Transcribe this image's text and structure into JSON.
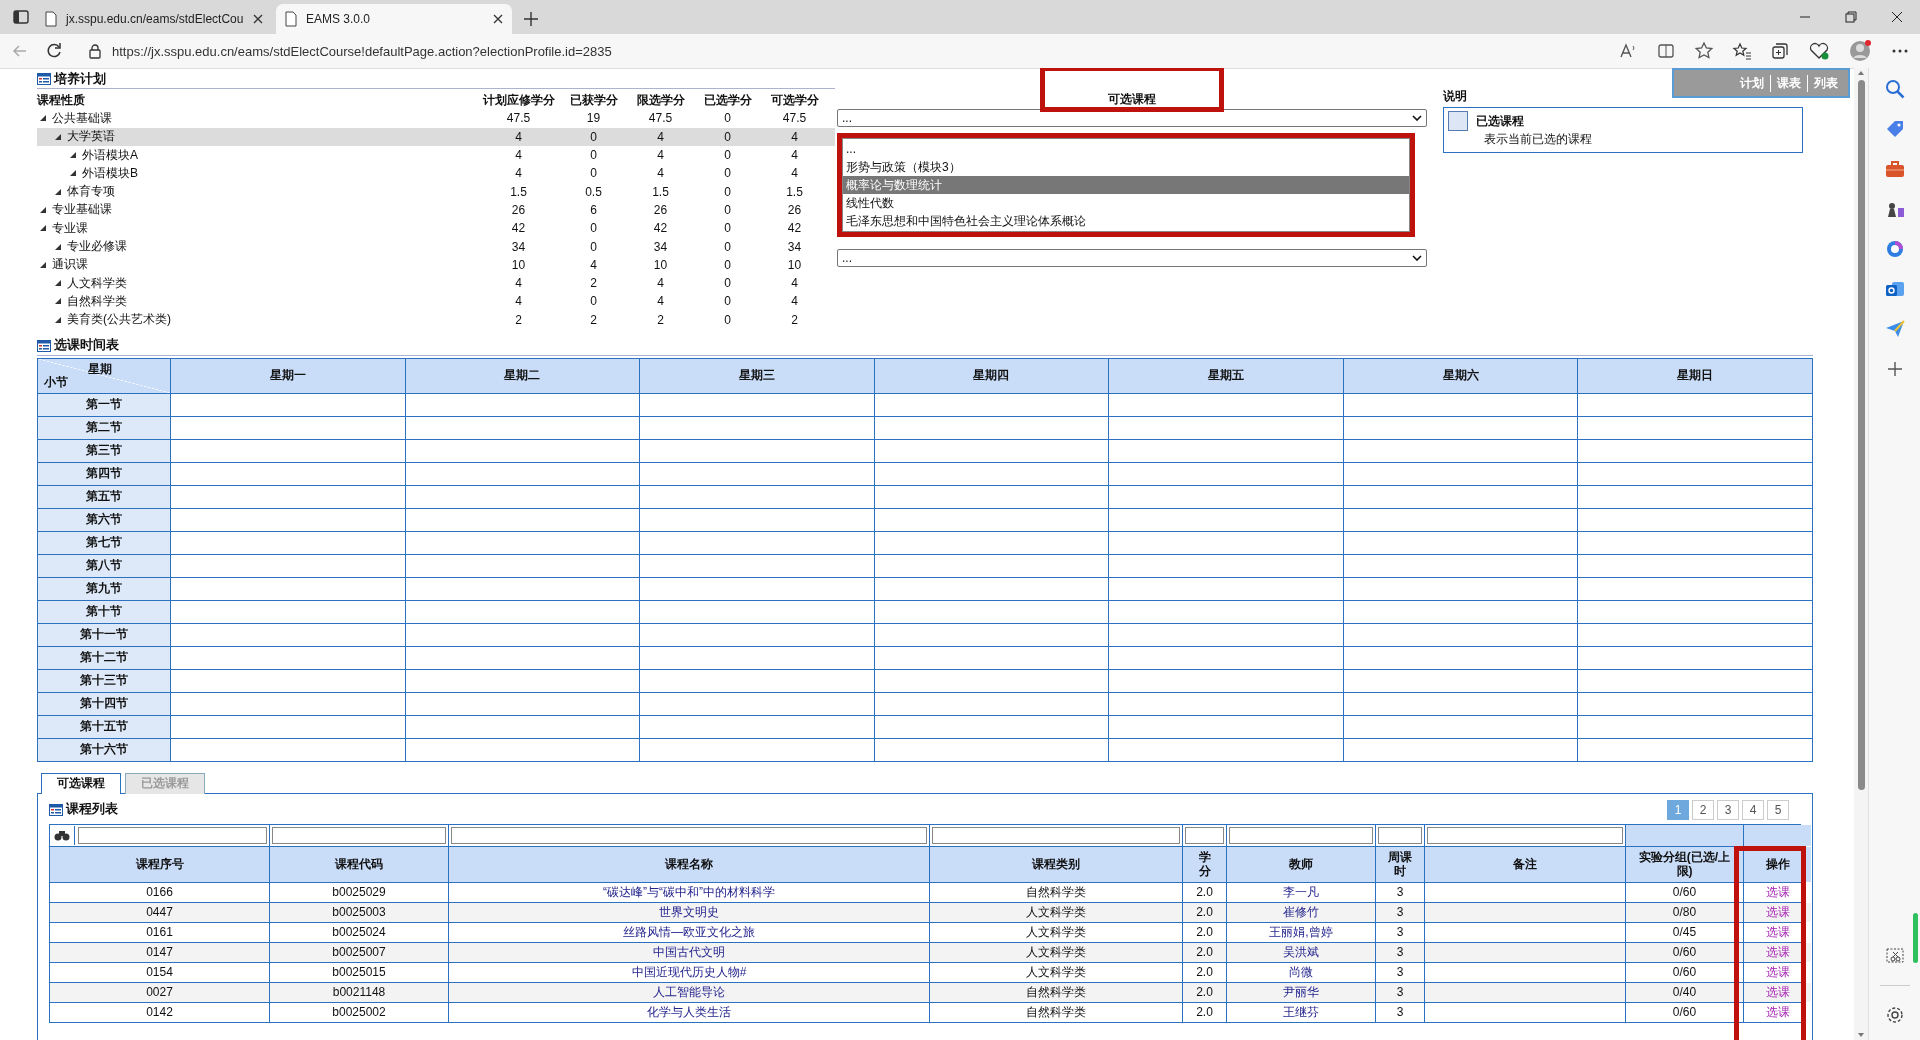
{
  "browser": {
    "tabs": [
      {
        "title": "jx.sspu.edu.cn/eams/stdElectCou",
        "selected": false
      },
      {
        "title": "EAMS 3.0.0",
        "selected": true
      }
    ],
    "address": "https://jx.sspu.edu.cn/eams/stdElectCourse!defaultPage.action?electionProfile.id=2835"
  },
  "view_links": [
    "计划",
    "课表",
    "列表"
  ],
  "plan": {
    "title": "培养计划",
    "columns": [
      "课程性质",
      "计划应修学分",
      "已获学分",
      "限选学分",
      "已选学分",
      "可选学分"
    ],
    "rows": [
      {
        "name": "公共基础课",
        "values": [
          "47.5",
          "19",
          "47.5",
          "0",
          "47.5"
        ],
        "selected": false,
        "expanded": true,
        "children": [
          {
            "name": "大学英语",
            "values": [
              "4",
              "0",
              "4",
              "0",
              "4"
            ],
            "selected": true,
            "expanded": true,
            "children": [
              {
                "name": "外语模块A",
                "values": [
                  "4",
                  "0",
                  "4",
                  "0",
                  "4"
                ],
                "selected": false,
                "expanded": true
              },
              {
                "name": "外语模块B",
                "values": [
                  "4",
                  "0",
                  "4",
                  "0",
                  "4"
                ],
                "selected": false,
                "expanded": true
              }
            ]
          },
          {
            "name": "体育专项",
            "values": [
              "1.5",
              "0.5",
              "1.5",
              "0",
              "1.5"
            ],
            "selected": false,
            "expanded": true
          }
        ]
      },
      {
        "name": "专业基础课",
        "values": [
          "26",
          "6",
          "26",
          "0",
          "26"
        ],
        "selected": false,
        "expanded": true
      },
      {
        "name": "专业课",
        "values": [
          "42",
          "0",
          "42",
          "0",
          "42"
        ],
        "selected": false,
        "expanded": true,
        "children": [
          {
            "name": "专业必修课",
            "values": [
              "34",
              "0",
              "34",
              "0",
              "34"
            ],
            "selected": false,
            "expanded": true
          }
        ]
      },
      {
        "name": "通识课",
        "values": [
          "10",
          "4",
          "10",
          "0",
          "10"
        ],
        "selected": false,
        "expanded": true,
        "children": [
          {
            "name": "人文科学类",
            "values": [
              "4",
              "2",
              "4",
              "0",
              "4"
            ],
            "selected": false,
            "expanded": true
          },
          {
            "name": "自然科学类",
            "values": [
              "4",
              "0",
              "4",
              "0",
              "4"
            ],
            "selected": false,
            "expanded": true
          },
          {
            "name": "美育类(公共艺术类)",
            "values": [
              "2",
              "2",
              "2",
              "0",
              "2"
            ],
            "selected": false,
            "expanded": true
          }
        ]
      }
    ]
  },
  "available": {
    "title": "可选课程",
    "top_select": "...",
    "options": [
      {
        "label": "...",
        "selected": false
      },
      {
        "label": "形势与政策（模块3）",
        "selected": false
      },
      {
        "label": "概率论与数理统计",
        "selected": true
      },
      {
        "label": "线性代数",
        "selected": false
      },
      {
        "label": "毛泽东思想和中国特色社会主义理论体系概论",
        "selected": false
      }
    ],
    "bottom_select": "..."
  },
  "legend": {
    "title": "说明",
    "items": [
      {
        "label": "已选课程",
        "description": "表示当前已选的课程"
      }
    ]
  },
  "timetable": {
    "title": "选课时间表",
    "corner_top": "星期",
    "corner_bottom": "小节",
    "days": [
      "星期一",
      "星期二",
      "星期三",
      "星期四",
      "星期五",
      "星期六",
      "星期日"
    ],
    "periods": [
      "第一节",
      "第二节",
      "第三节",
      "第四节",
      "第五节",
      "第六节",
      "第七节",
      "第八节",
      "第九节",
      "第十节",
      "第十一节",
      "第十二节",
      "第十三节",
      "第十四节",
      "第十五节",
      "第十六节"
    ]
  },
  "panel_tabs": [
    {
      "label": "可选课程",
      "selected": true
    },
    {
      "label": "已选课程",
      "selected": false
    }
  ],
  "course_list": {
    "title": "课程列表",
    "pages": [
      {
        "label": "1",
        "selected": true
      },
      {
        "label": "2",
        "selected": false
      },
      {
        "label": "3",
        "selected": false
      },
      {
        "label": "4",
        "selected": false
      },
      {
        "label": "5",
        "selected": false
      }
    ],
    "columns": [
      "课程序号",
      "课程代码",
      "课程名称",
      "课程类别",
      "学分",
      "教师",
      "周课时",
      "备注",
      "实验分组(已选/上限)",
      "操作"
    ],
    "rows": [
      {
        "no": "0166",
        "code": "b0025029",
        "name": "“碳达峰”与“碳中和”中的材料科学",
        "category": "自然科学类",
        "credit": "2.0",
        "teacher": "李一凡",
        "hours": "3",
        "group": "0/60",
        "action": "选课"
      },
      {
        "no": "0447",
        "code": "b0025003",
        "name": "世界文明史",
        "category": "人文科学类",
        "credit": "2.0",
        "teacher": "崔修竹",
        "hours": "3",
        "group": "0/80",
        "action": "选课"
      },
      {
        "no": "0161",
        "code": "b0025024",
        "name": "丝路风情—欧亚文化之旅",
        "category": "人文科学类",
        "credit": "2.0",
        "teacher": "王丽娟,曾婷",
        "hours": "3",
        "group": "0/45",
        "action": "选课"
      },
      {
        "no": "0147",
        "code": "b0025007",
        "name": "中国古代文明",
        "category": "人文科学类",
        "credit": "2.0",
        "teacher": "吴洪斌",
        "hours": "3",
        "group": "0/60",
        "action": "选课"
      },
      {
        "no": "0154",
        "code": "b0025015",
        "name": "中国近现代历史人物#",
        "category": "人文科学类",
        "credit": "2.0",
        "teacher": "尚微",
        "hours": "3",
        "group": "0/60",
        "action": "选课"
      },
      {
        "no": "0027",
        "code": "b0021148",
        "name": "人工智能导论",
        "category": "自然科学类",
        "credit": "2.0",
        "teacher": "尹丽华",
        "hours": "3",
        "group": "0/40",
        "action": "选课"
      },
      {
        "no": "0142",
        "code": "b0025002",
        "name": "化学与人类生活",
        "category": "自然科学类",
        "credit": "2.0",
        "teacher": "王继芬",
        "hours": "3",
        "group": "0/60",
        "action": "选课"
      }
    ]
  }
}
